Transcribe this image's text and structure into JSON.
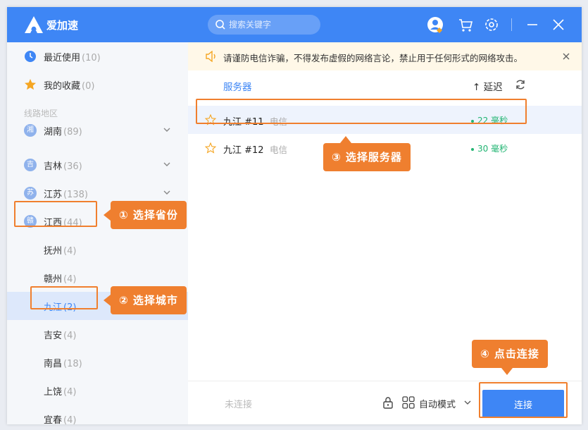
{
  "app": {
    "title": "爱加速"
  },
  "search": {
    "placeholder": "搜索关键字"
  },
  "colors": {
    "accent": "#3e86f5",
    "callout": "#ef7f2f",
    "latency_good": "#22b573"
  },
  "sidebar": {
    "recent": {
      "label": "最近使用",
      "count": "(10)"
    },
    "favorites": {
      "label": "我的收藏",
      "count": "(0)"
    },
    "section_title": "线路地区",
    "provinces": [
      {
        "badge": "湘",
        "label": "湖南",
        "count": "(89)"
      },
      {
        "badge": "吉",
        "label": "吉林",
        "count": "(36)"
      },
      {
        "badge": "苏",
        "label": "江苏",
        "count": "(138)"
      },
      {
        "badge": "赣",
        "label": "江西",
        "count": "(44)"
      }
    ],
    "cities": [
      {
        "label": "抚州",
        "count": "(4)"
      },
      {
        "label": "赣州",
        "count": "(4)"
      },
      {
        "label": "九江",
        "count": "(2)"
      },
      {
        "label": "吉安",
        "count": "(4)"
      },
      {
        "label": "南昌",
        "count": "(18)"
      },
      {
        "label": "上饶",
        "count": "(4)"
      },
      {
        "label": "宜春",
        "count": "(4)"
      }
    ]
  },
  "notice": {
    "text": "请谨防电信诈骗，不得发布虚假的网络言论，禁止用于任何形式的网络攻击。"
  },
  "table": {
    "header_server": "服务器",
    "header_delay": "↑ 延迟",
    "rows": [
      {
        "name": "九江 #11",
        "isp": "电信",
        "delay": "22 毫秒"
      },
      {
        "name": "九江 #12",
        "isp": "电信",
        "delay": "30 毫秒"
      }
    ]
  },
  "bottom": {
    "status": "未连接",
    "mode": "自动模式",
    "connect_label": "连接"
  },
  "callouts": {
    "step1": "① 选择省份",
    "step2": "② 选择城市",
    "step3": "③ 选择服务器",
    "step4": "④ 点击连接"
  }
}
